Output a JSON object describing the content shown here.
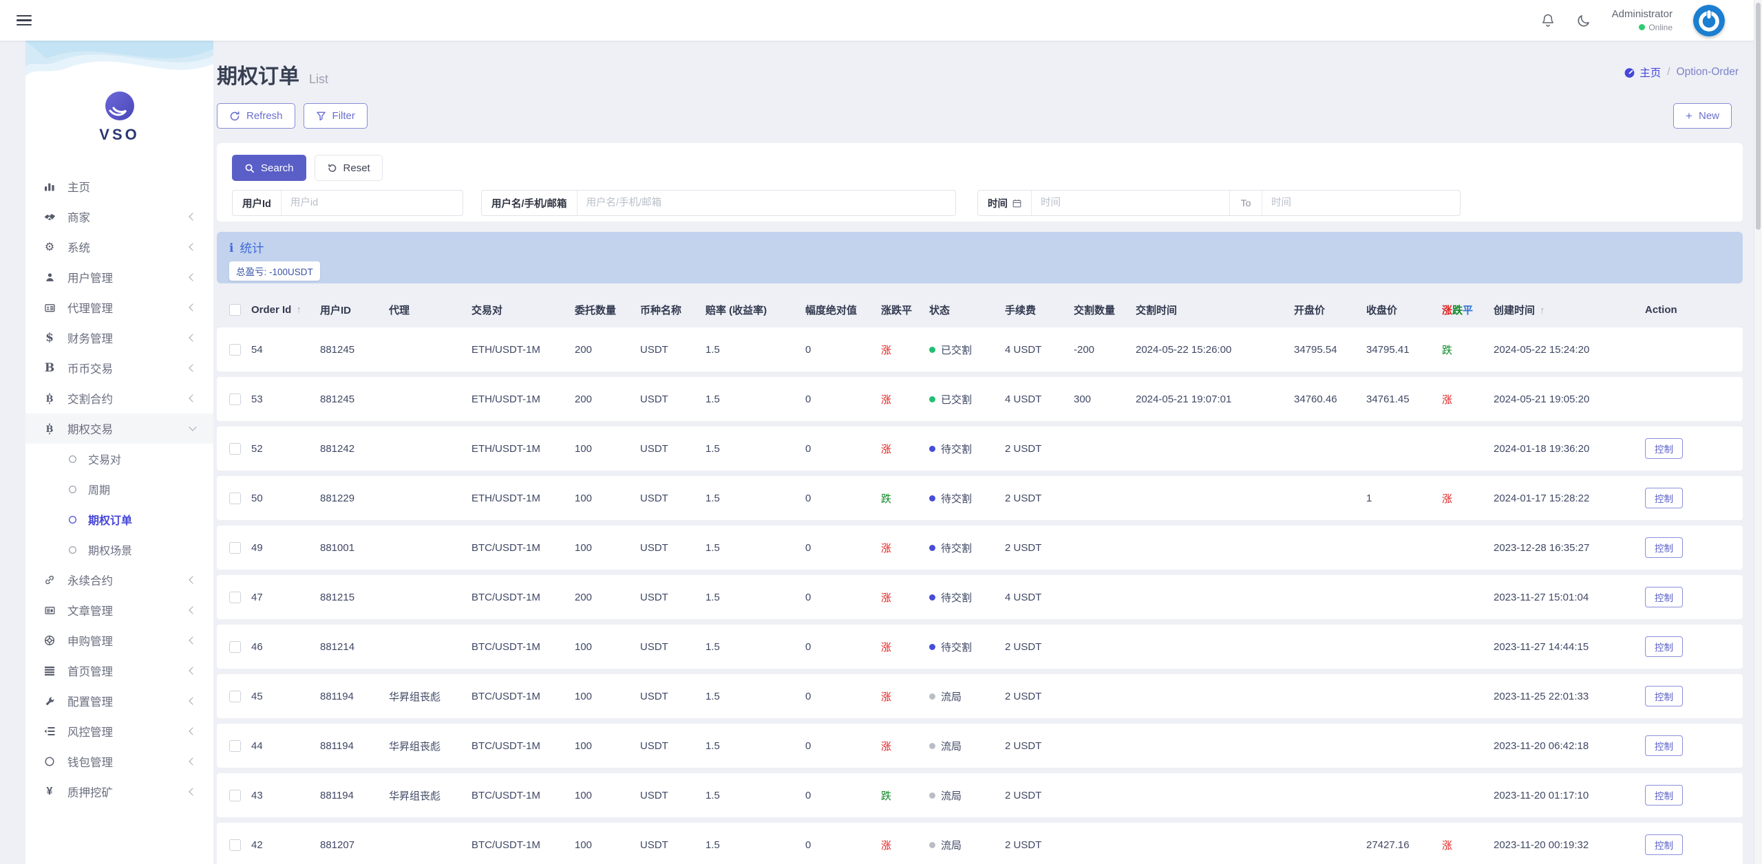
{
  "colors": {
    "accent": "#5a5fc7",
    "link": "#4646d8",
    "up_red": "#e02222",
    "down_green": "#0b8a25",
    "flat_blue": "#2f6fd6",
    "banner_bg": "#c3d3ee",
    "status_delivered_dot": "#21bf73",
    "status_pending_dot": "#474dd8",
    "status_void_dot": "#b9bdc5",
    "online_green": "#2ecc71"
  },
  "navbar": {
    "user_name": "Administrator",
    "user_status": "Online"
  },
  "sidebar": {
    "logo": "VSO",
    "items": [
      {
        "label": "主页",
        "icon": "chart-bars-icon",
        "chevron": null
      },
      {
        "label": "商家",
        "icon": "handshake-icon",
        "chevron": "left"
      },
      {
        "label": "系统",
        "icon": "gear-icon",
        "chevron": "left"
      },
      {
        "label": "用户管理",
        "icon": "user-icon",
        "chevron": "left"
      },
      {
        "label": "代理管理",
        "icon": "id-card-icon",
        "chevron": "left"
      },
      {
        "label": "财务管理",
        "icon": "dollar-icon",
        "chevron": "left"
      },
      {
        "label": "币币交易",
        "icon": "letter-b-icon",
        "chevron": "left"
      },
      {
        "label": "交割合约",
        "icon": "bitcoin-b-icon",
        "chevron": "left"
      },
      {
        "label": "期权交易",
        "icon": "bitcoin-b-icon",
        "chevron": "down",
        "expanded": true,
        "children": [
          {
            "label": "交易对",
            "active": false
          },
          {
            "label": "周期",
            "active": false
          },
          {
            "label": "期权订单",
            "active": true
          },
          {
            "label": "期权场景",
            "active": false
          }
        ]
      },
      {
        "label": "永续合约",
        "icon": "link-icon",
        "chevron": "left"
      },
      {
        "label": "文章管理",
        "icon": "newspaper-icon",
        "chevron": "left"
      },
      {
        "label": "申购管理",
        "icon": "lifering-icon",
        "chevron": "left"
      },
      {
        "label": "首页管理",
        "icon": "list-bars-icon",
        "chevron": "left"
      },
      {
        "label": "配置管理",
        "icon": "wrench-icon",
        "chevron": "left"
      },
      {
        "label": "风控管理",
        "icon": "outdent-icon",
        "chevron": "left"
      },
      {
        "label": "钱包管理",
        "icon": "circle-icon",
        "chevron": "left"
      },
      {
        "label": "质押挖矿",
        "icon": "yen-icon",
        "chevron": "left"
      }
    ]
  },
  "page_header": {
    "title": "期权订单",
    "subtitle": "List",
    "breadcrumb_home": "主页",
    "breadcrumb_sep": "/",
    "breadcrumb_current": "Option-Order"
  },
  "toolbar": {
    "refresh": "Refresh",
    "filter": "Filter",
    "new_label": "New"
  },
  "search": {
    "search_label": "Search",
    "reset_label": "Reset",
    "user_id": {
      "label": "用户Id",
      "placeholder": "用户id"
    },
    "user_name": {
      "label": "用户名/手机/邮箱",
      "placeholder": "用户名/手机/邮箱"
    },
    "time": {
      "label": "时间",
      "placeholder_from": "时间",
      "to_label": "To",
      "placeholder_to": "时间"
    }
  },
  "stats": {
    "title": "统计",
    "total_pl": "总盈亏: -100USDT"
  },
  "table": {
    "headers": [
      "",
      "Order Id",
      "用户ID",
      "代理",
      "交易对",
      "委托数量",
      "币种名称",
      "赔率 (收益率)",
      "幅度绝对值",
      "涨跌平",
      "状态",
      "手续费",
      "交割数量",
      "交割时间",
      "开盘价",
      "收盘价",
      "涨跌平",
      "创建时间",
      "Action"
    ],
    "sort_indices": [
      1,
      17
    ],
    "colored_index": 16,
    "action_label": "控制",
    "rows": [
      {
        "order_id": "54",
        "user_id": "881245",
        "agent": "",
        "pair": "ETH/USDT-1M",
        "amount": "200",
        "coin": "USDT",
        "odds": "1.5",
        "range": "0",
        "updown": "涨",
        "status": "已交割",
        "status_type": "delivered",
        "fee": "4 USDT",
        "delivery_qty": "-200",
        "delivery_time": "2024-05-22 15:26:00",
        "open_price": "34795.54",
        "close_price": "34795.41",
        "result": "跌",
        "created_at": "2024-05-22 15:24:20",
        "action": false
      },
      {
        "order_id": "53",
        "user_id": "881245",
        "agent": "",
        "pair": "ETH/USDT-1M",
        "amount": "200",
        "coin": "USDT",
        "odds": "1.5",
        "range": "0",
        "updown": "涨",
        "status": "已交割",
        "status_type": "delivered",
        "fee": "4 USDT",
        "delivery_qty": "300",
        "delivery_time": "2024-05-21 19:07:01",
        "open_price": "34760.46",
        "close_price": "34761.45",
        "result": "涨",
        "created_at": "2024-05-21 19:05:20",
        "action": false
      },
      {
        "order_id": "52",
        "user_id": "881242",
        "agent": "",
        "pair": "ETH/USDT-1M",
        "amount": "100",
        "coin": "USDT",
        "odds": "1.5",
        "range": "0",
        "updown": "涨",
        "status": "待交割",
        "status_type": "pending",
        "fee": "2 USDT",
        "delivery_qty": "",
        "delivery_time": "",
        "open_price": "",
        "close_price": "",
        "result": "",
        "created_at": "2024-01-18 19:36:20",
        "action": true
      },
      {
        "order_id": "50",
        "user_id": "881229",
        "agent": "",
        "pair": "ETH/USDT-1M",
        "amount": "100",
        "coin": "USDT",
        "odds": "1.5",
        "range": "0",
        "updown": "跌",
        "status": "待交割",
        "status_type": "pending",
        "fee": "2 USDT",
        "delivery_qty": "",
        "delivery_time": "",
        "open_price": "",
        "close_price": "1",
        "result": "涨",
        "created_at": "2024-01-17 15:28:22",
        "action": true
      },
      {
        "order_id": "49",
        "user_id": "881001",
        "agent": "",
        "pair": "BTC/USDT-1M",
        "amount": "100",
        "coin": "USDT",
        "odds": "1.5",
        "range": "0",
        "updown": "涨",
        "status": "待交割",
        "status_type": "pending",
        "fee": "2 USDT",
        "delivery_qty": "",
        "delivery_time": "",
        "open_price": "",
        "close_price": "",
        "result": "",
        "created_at": "2023-12-28 16:35:27",
        "action": true
      },
      {
        "order_id": "47",
        "user_id": "881215",
        "agent": "",
        "pair": "BTC/USDT-1M",
        "amount": "200",
        "coin": "USDT",
        "odds": "1.5",
        "range": "0",
        "updown": "涨",
        "status": "待交割",
        "status_type": "pending",
        "fee": "4 USDT",
        "delivery_qty": "",
        "delivery_time": "",
        "open_price": "",
        "close_price": "",
        "result": "",
        "created_at": "2023-11-27 15:01:04",
        "action": true
      },
      {
        "order_id": "46",
        "user_id": "881214",
        "agent": "",
        "pair": "BTC/USDT-1M",
        "amount": "100",
        "coin": "USDT",
        "odds": "1.5",
        "range": "0",
        "updown": "涨",
        "status": "待交割",
        "status_type": "pending",
        "fee": "2 USDT",
        "delivery_qty": "",
        "delivery_time": "",
        "open_price": "",
        "close_price": "",
        "result": "",
        "created_at": "2023-11-27 14:44:15",
        "action": true
      },
      {
        "order_id": "45",
        "user_id": "881194",
        "agent": "华昇组丧彪",
        "pair": "BTC/USDT-1M",
        "amount": "100",
        "coin": "USDT",
        "odds": "1.5",
        "range": "0",
        "updown": "涨",
        "status": "流局",
        "status_type": "void",
        "fee": "2 USDT",
        "delivery_qty": "",
        "delivery_time": "",
        "open_price": "",
        "close_price": "",
        "result": "",
        "created_at": "2023-11-25 22:01:33",
        "action": true
      },
      {
        "order_id": "44",
        "user_id": "881194",
        "agent": "华昇组丧彪",
        "pair": "BTC/USDT-1M",
        "amount": "100",
        "coin": "USDT",
        "odds": "1.5",
        "range": "0",
        "updown": "涨",
        "status": "流局",
        "status_type": "void",
        "fee": "2 USDT",
        "delivery_qty": "",
        "delivery_time": "",
        "open_price": "",
        "close_price": "",
        "result": "",
        "created_at": "2023-11-20 06:42:18",
        "action": true
      },
      {
        "order_id": "43",
        "user_id": "881194",
        "agent": "华昇组丧彪",
        "pair": "BTC/USDT-1M",
        "amount": "100",
        "coin": "USDT",
        "odds": "1.5",
        "range": "0",
        "updown": "跌",
        "status": "流局",
        "status_type": "void",
        "fee": "2 USDT",
        "delivery_qty": "",
        "delivery_time": "",
        "open_price": "",
        "close_price": "",
        "result": "",
        "created_at": "2023-11-20 01:17:10",
        "action": true
      },
      {
        "order_id": "42",
        "user_id": "881207",
        "agent": "",
        "pair": "BTC/USDT-1M",
        "amount": "100",
        "coin": "USDT",
        "odds": "1.5",
        "range": "0",
        "updown": "涨",
        "status": "流局",
        "status_type": "void",
        "fee": "2 USDT",
        "delivery_qty": "",
        "delivery_time": "",
        "open_price": "",
        "close_price": "27427.16",
        "result": "涨",
        "created_at": "2023-11-20 00:19:32",
        "action": true
      }
    ]
  }
}
